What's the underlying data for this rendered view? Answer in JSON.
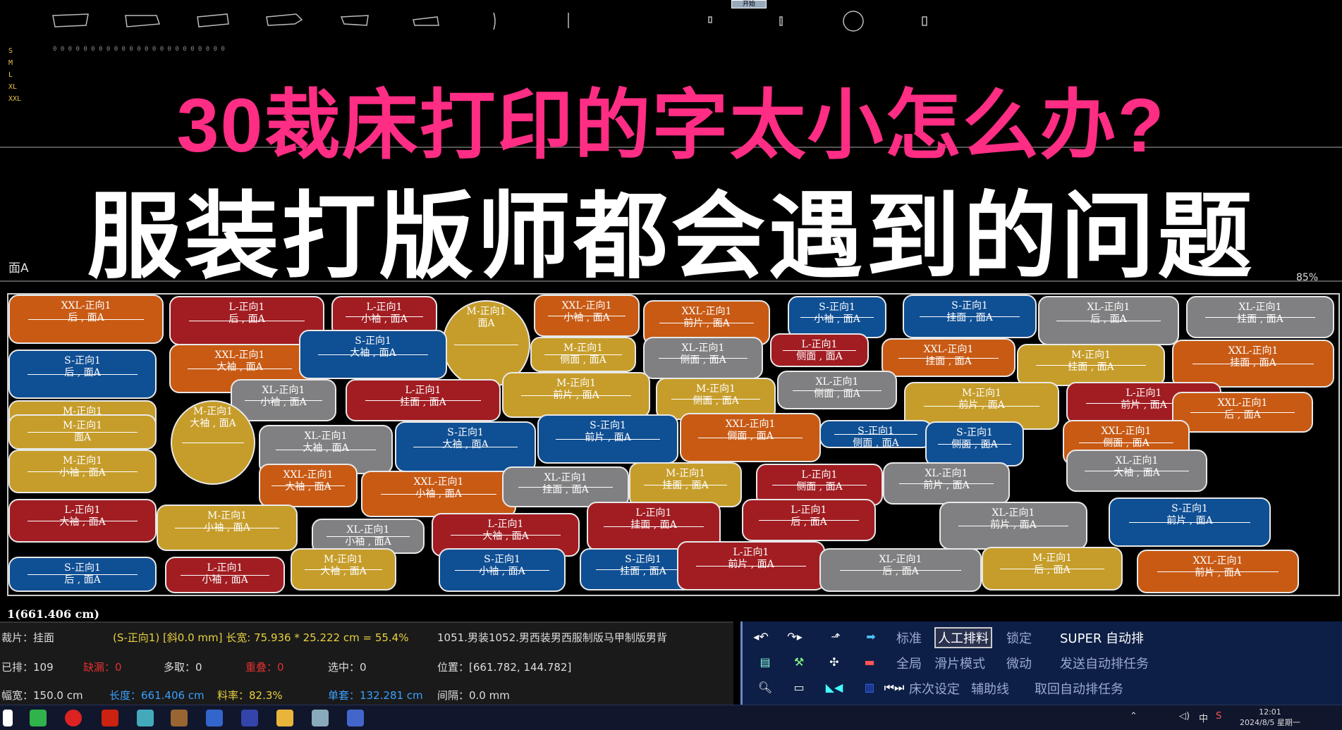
{
  "top_button": "开始",
  "size_labels": [
    "S",
    "M",
    "L",
    "XL",
    "XXL"
  ],
  "headline_1": "30裁床打印的字太小怎么办?",
  "headline_2": "服装打版师都会遇到的问题",
  "face_label": "面A",
  "zoom_label": "85%",
  "marker_pieces": [
    {
      "l1": "XXL-正向1",
      "l2": "后 , 面A",
      "color": "orange"
    },
    {
      "l1": "L-正向1",
      "l2": "后 , 面A",
      "color": "red"
    },
    {
      "l1": "L-正向1",
      "l2": "小袖 , 面A",
      "color": "red"
    },
    {
      "l1": "M-正向1",
      "l2": "面A",
      "color": "gold"
    },
    {
      "l1": "XXL-正向1",
      "l2": "小袖 , 面A",
      "color": "orange"
    },
    {
      "l1": "XXL-正向1",
      "l2": "前片 , 面A",
      "color": "orange"
    },
    {
      "l1": "S-正向1",
      "l2": "小袖 , 面A",
      "color": "blue"
    },
    {
      "l1": "S-正向1",
      "l2": "挂面 , 面A",
      "color": "blue"
    },
    {
      "l1": "XL-正向1",
      "l2": "后 , 面A",
      "color": "gray"
    },
    {
      "l1": "XL-正向1",
      "l2": "挂面 , 面A",
      "color": "gray"
    },
    {
      "l1": "S-正向1",
      "l2": "后 , 面A",
      "color": "blue"
    },
    {
      "l1": "XXL-正向1",
      "l2": "大袖 , 面A",
      "color": "orange"
    },
    {
      "l1": "S-正向1",
      "l2": "大袖 , 面A",
      "color": "blue"
    },
    {
      "l1": "M-正向1",
      "l2": "侧面 , 面A",
      "color": "gold"
    },
    {
      "l1": "XL-正向1",
      "l2": "侧面 , 面A",
      "color": "gray"
    },
    {
      "l1": "L-正向1",
      "l2": "侧面 , 面A",
      "color": "red"
    },
    {
      "l1": "XXL-正向1",
      "l2": "挂面 , 面A",
      "color": "orange"
    },
    {
      "l1": "M-正向1",
      "l2": "挂面 , 面A",
      "color": "gold"
    },
    {
      "l1": "XXL-正向1",
      "l2": "挂面 , 面A",
      "color": "orange"
    },
    {
      "l1": "M-正向1",
      "l2": "后 , 面A",
      "color": "gold"
    },
    {
      "l1": "XL-正向1",
      "l2": "小袖 , 面A",
      "color": "gray"
    },
    {
      "l1": "L-正向1",
      "l2": "挂面 , 面A",
      "color": "red"
    },
    {
      "l1": "M-正向1",
      "l2": "前片 , 面A",
      "color": "gold"
    },
    {
      "l1": "M-正向1",
      "l2": "侧面 , 面A",
      "color": "gold"
    },
    {
      "l1": "XL-正向1",
      "l2": "侧面 , 面A",
      "color": "gray"
    },
    {
      "l1": "M-正向1",
      "l2": "前片 , 面A",
      "color": "gold"
    },
    {
      "l1": "L-正向1",
      "l2": "前片 , 面A",
      "color": "red"
    },
    {
      "l1": "XXL-正向1",
      "l2": "后 , 面A",
      "color": "orange"
    },
    {
      "l1": "M-正向1",
      "l2": "面A",
      "color": "gold"
    },
    {
      "l1": "M-正向1",
      "l2": "大袖 , 面A",
      "color": "gold"
    },
    {
      "l1": "XL-正向1",
      "l2": "大袖 , 面A",
      "color": "gray"
    },
    {
      "l1": "S-正向1",
      "l2": "大袖 , 面A",
      "color": "blue"
    },
    {
      "l1": "S-正向1",
      "l2": "前片 , 面A",
      "color": "blue"
    },
    {
      "l1": "XXL-正向1",
      "l2": "侧面 , 面A",
      "color": "orange"
    },
    {
      "l1": "S-正向1",
      "l2": "侧面 , 面A",
      "color": "blue"
    },
    {
      "l1": "S-正向1",
      "l2": "侧面 , 面A",
      "color": "blue"
    },
    {
      "l1": "XXL-正向1",
      "l2": "侧面 , 面A",
      "color": "orange"
    },
    {
      "l1": "M-正向1",
      "l2": "小袖 , 面A",
      "color": "gold"
    },
    {
      "l1": "XXL-正向1",
      "l2": "大袖 , 面A",
      "color": "orange"
    },
    {
      "l1": "XXL-正向1",
      "l2": "小袖 , 面A",
      "color": "orange"
    },
    {
      "l1": "XL-正向1",
      "l2": "挂面 , 面A",
      "color": "gray"
    },
    {
      "l1": "M-正向1",
      "l2": "挂面 , 面A",
      "color": "gold"
    },
    {
      "l1": "L-正向1",
      "l2": "侧面 , 面A",
      "color": "red"
    },
    {
      "l1": "XL-正向1",
      "l2": "前片 , 面A",
      "color": "gray"
    },
    {
      "l1": "XL-正向1",
      "l2": "大袖 , 面A",
      "color": "gray"
    },
    {
      "l1": "L-正向1",
      "l2": "大袖 , 面A",
      "color": "red"
    },
    {
      "l1": "M-正向1",
      "l2": "小袖 , 面A",
      "color": "gold"
    },
    {
      "l1": "XL-正向1",
      "l2": "小袖 , 面A",
      "color": "gray"
    },
    {
      "l1": "L-正向1",
      "l2": "大袖 , 面A",
      "color": "red"
    },
    {
      "l1": "L-正向1",
      "l2": "挂面 , 面A",
      "color": "red"
    },
    {
      "l1": "L-正向1",
      "l2": "后 , 面A",
      "color": "red"
    },
    {
      "l1": "XL-正向1",
      "l2": "前片 , 面A",
      "color": "gray"
    },
    {
      "l1": "S-正向1",
      "l2": "前片 , 面A",
      "color": "blue"
    },
    {
      "l1": "S-正向1",
      "l2": "后 , 面A",
      "color": "blue"
    },
    {
      "l1": "L-正向1",
      "l2": "小袖 , 面A",
      "color": "red"
    },
    {
      "l1": "M-正向1",
      "l2": "大袖 , 面A",
      "color": "gold"
    },
    {
      "l1": "S-正向1",
      "l2": "小袖 , 面A",
      "color": "blue"
    },
    {
      "l1": "S-正向1",
      "l2": "挂面 , 面A",
      "color": "blue"
    },
    {
      "l1": "L-正向1",
      "l2": "前片 , 面A",
      "color": "red"
    },
    {
      "l1": "XL-正向1",
      "l2": "后 , 面A",
      "color": "gray"
    },
    {
      "l1": "M-正向1",
      "l2": "后 , 面A",
      "color": "gold"
    },
    {
      "l1": "XXL-正向1",
      "l2": "前片 , 面A",
      "color": "orange"
    }
  ],
  "position_text": "1(661.406 cm)",
  "status": {
    "cut_piece": "裁片：挂面",
    "piece_info": "(S-正向1) [斜0.0 mm]  长宽: 75.936 * 25.222 cm = 55.4%",
    "file_name": "1051.男装1052.男西装男西服制版马甲制版男背",
    "placed": "已排：109",
    "missing_label": "缺漏：0",
    "extra": "多取：0",
    "overlap_label": "重叠：0",
    "selected": "选中：0",
    "position": "位置：[661.782, 144.782]",
    "width": "幅宽：150.0 cm",
    "length": "长度：661.406 cm",
    "rate": "料率：82.3%",
    "unit": "单套：132.281 cm",
    "gap": "间隔：0.0 mm"
  },
  "tools": {
    "standard": "标准",
    "manual": "人工排料",
    "lock": "锁定",
    "super_auto": "SUPER 自动排",
    "global": "全局",
    "slide_mode": "滑片模式",
    "fine": "微动",
    "send_task": "发送自动排任务",
    "bed_setting": "床次设定",
    "aux_line": "辅助线",
    "fetch_task": "取回自动排任务"
  },
  "taskbar": {
    "ime": "中",
    "time": "12:01",
    "date": "2024/8/5 星期一"
  },
  "colors": {
    "headline_pink": "#ff2d84",
    "orange": "#c85a14",
    "red": "#a11d22",
    "blue": "#0f4f94",
    "gold": "#c69d2a",
    "gray": "#808082",
    "tool_panel_bg": "#0d1f46"
  }
}
